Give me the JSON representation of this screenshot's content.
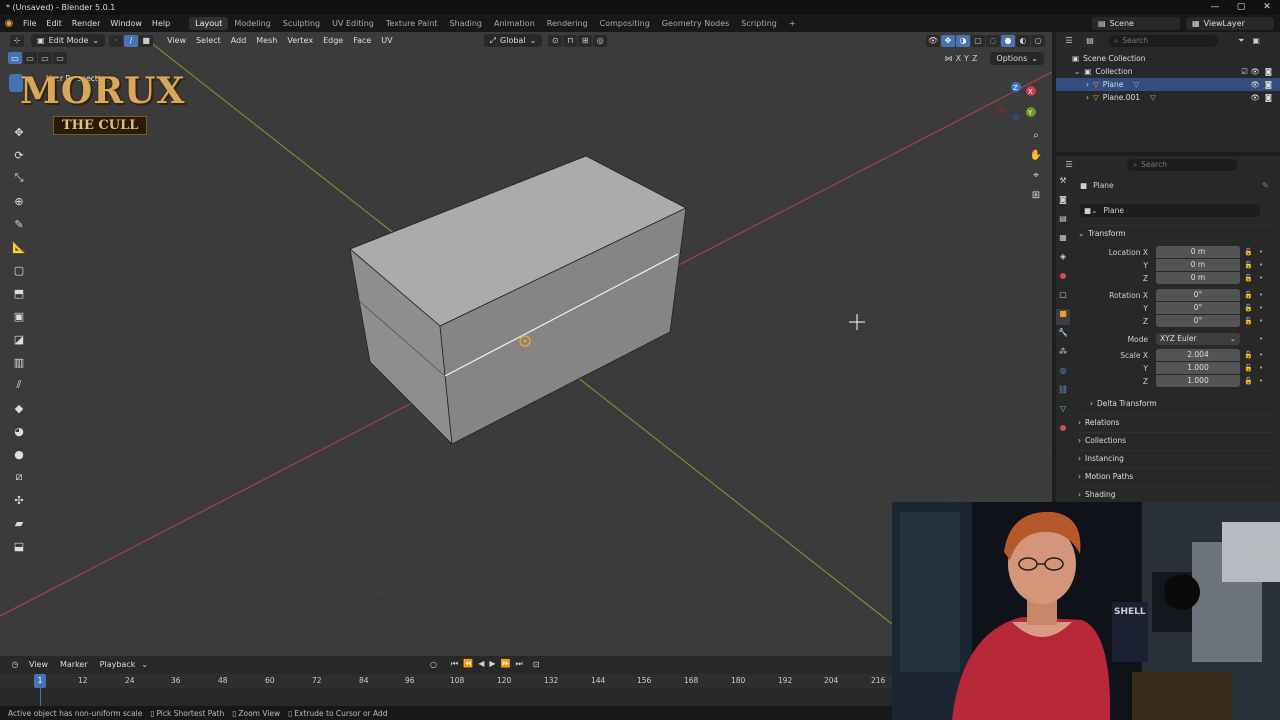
{
  "window": {
    "title": "* (Unsaved) - Blender 5.0.1",
    "buttons": [
      "—",
      "▢",
      "✕"
    ]
  },
  "menu": {
    "items": [
      "File",
      "Edit",
      "Render",
      "Window",
      "Help"
    ],
    "workspaces": [
      "Layout",
      "Modeling",
      "Sculpting",
      "UV Editing",
      "Texture Paint",
      "Shading",
      "Animation",
      "Rendering",
      "Compositing",
      "Geometry Nodes",
      "Scripting",
      "+"
    ],
    "scene": "Scene",
    "view_layer": "ViewLayer"
  },
  "viewport": {
    "mode": "Edit Mode",
    "menu": [
      "View",
      "Select",
      "Add",
      "Mesh",
      "Vertex",
      "Edge",
      "Face",
      "UV"
    ],
    "transform_orientation": "Global",
    "options": "Options",
    "perspective_label": "User Perspective",
    "axes": [
      "X",
      "Y",
      "Z"
    ]
  },
  "logo": {
    "line1": "MORUX",
    "line2": "THE CULL"
  },
  "outliner": {
    "search_placeholder": "Search",
    "root": "Scene Collection",
    "collection": "Collection",
    "objects": [
      "Plane",
      "Plane.001"
    ]
  },
  "properties": {
    "search_placeholder": "Search",
    "object_name": "Plane",
    "data_name": "Plane",
    "transform_header": "Transform",
    "location_label": "Location X",
    "rotation_label": "Rotation X",
    "scale_label": "Scale X",
    "y_label": "Y",
    "z_label": "Z",
    "location": [
      "0 m",
      "0 m",
      "0 m"
    ],
    "rotation": [
      "0°",
      "0°",
      "0°"
    ],
    "mode_label": "Mode",
    "mode_value": "XYZ Euler",
    "scale": [
      "2.004",
      "1.000",
      "1.000"
    ],
    "sections": [
      "Delta Transform",
      "Relations",
      "Collections",
      "Instancing",
      "Motion Paths",
      "Shading"
    ]
  },
  "timeline": {
    "menu": [
      "View",
      "Marker",
      "Playback"
    ],
    "current_frame": "1",
    "frame_marks": [
      "12",
      "24",
      "36",
      "48",
      "60",
      "72",
      "84",
      "96",
      "108",
      "120",
      "132",
      "144",
      "156",
      "168",
      "180",
      "192",
      "204",
      "216"
    ],
    "playhead": "1"
  },
  "status": [
    "Active object has non-uniform scale",
    "Pick Shortest Path",
    "Zoom View",
    "Extrude to Cursor or Add"
  ],
  "webcam": {
    "shirt_text": "SHELL"
  }
}
